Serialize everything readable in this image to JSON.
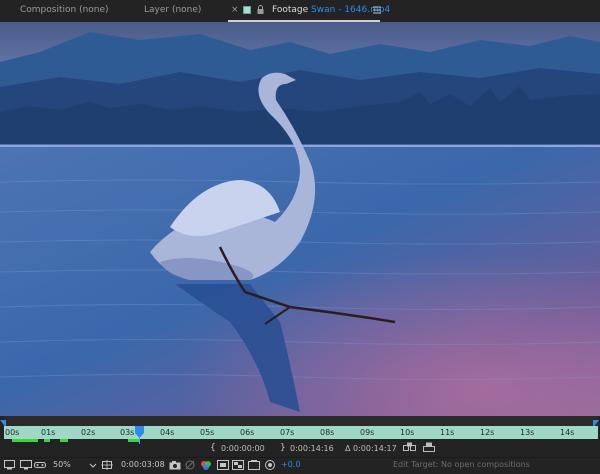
{
  "tabs": {
    "composition": "Composition (none)",
    "layer": "Layer (none)",
    "footage_prefix": "Footage",
    "footage_file": "Swan - 1646.mp4"
  },
  "ruler": {
    "labels": [
      "00s",
      "01s",
      "02s",
      "03s",
      "04s",
      "05s",
      "06s",
      "07s",
      "08s",
      "09s",
      "10s",
      "11s",
      "12s",
      "13s",
      "14s"
    ]
  },
  "timecodes": {
    "in_point": "0:00:00:00",
    "out_point": "0:00:14:16",
    "duration": "Δ 0:00:14:17"
  },
  "bottombar": {
    "zoom": "50%",
    "current_time": "0:00:03:08",
    "exposure": "+0.0",
    "edit_target": "Edit Target: No open compositions"
  },
  "colors": {
    "accent": "#2d8ceb",
    "ruler": "#9fd8c7",
    "cache": "#3cd43c"
  }
}
